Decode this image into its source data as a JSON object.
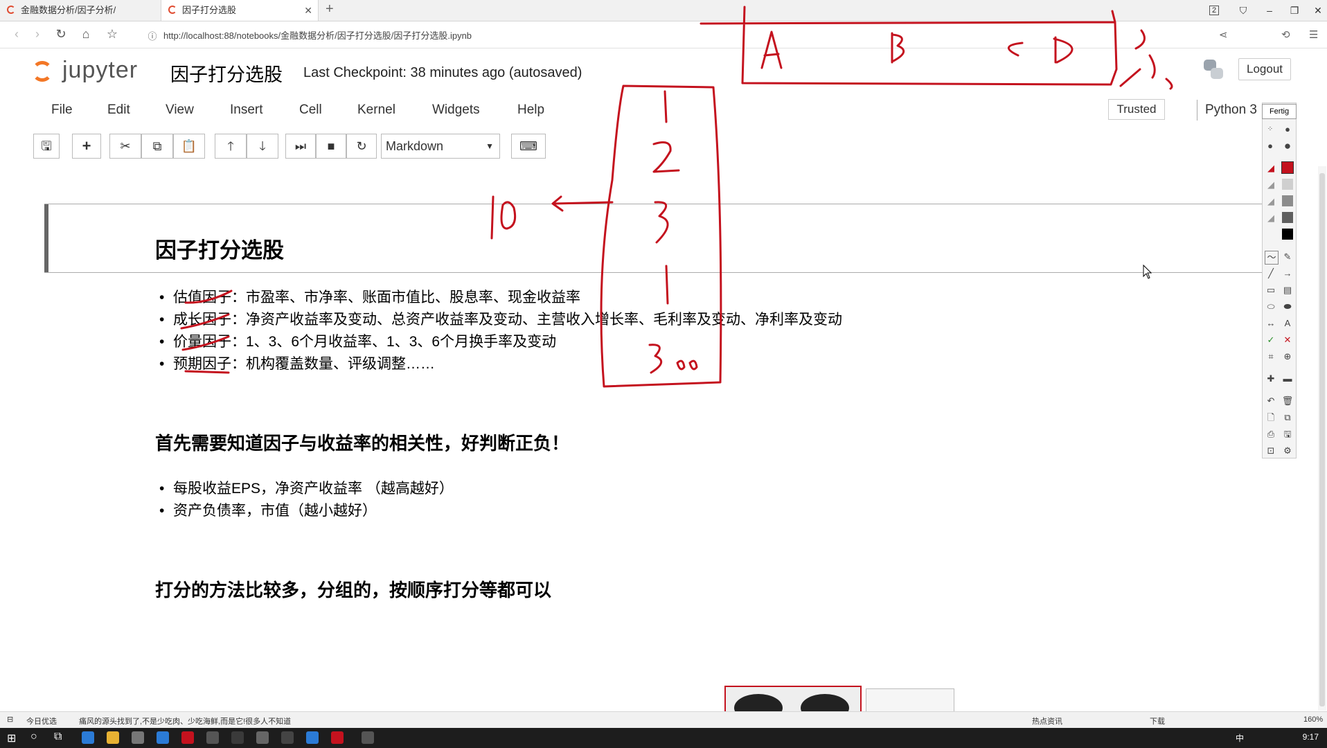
{
  "browser": {
    "tabs": [
      {
        "label": "金融数据分析/因子分析/"
      },
      {
        "label": "因子打分选股"
      }
    ],
    "url": "http://localhost:88/notebooks/金融数据分析/因子打分选股/因子打分选股.ipynb",
    "tab_counter": "2"
  },
  "jupyter": {
    "logo_text": "jupyter",
    "notebook_title": "因子打分选股",
    "checkpoint": "Last Checkpoint: 38 minutes ago (autosaved)",
    "logout": "Logout",
    "trusted": "Trusted",
    "kernel": "Python 3",
    "menu": [
      "File",
      "Edit",
      "View",
      "Insert",
      "Cell",
      "Kernel",
      "Widgets",
      "Help"
    ],
    "cell_type": "Markdown"
  },
  "notebook": {
    "heading": "因子打分选股",
    "factors": [
      "估值因子：市盈率、市净率、账面市值比、股息率、现金收益率",
      "成长因子：净资产收益率及变动、总资产收益率及变动、主营收入增长率、毛利率及变动、净利率及变动",
      "价量因子：1、3、6个月收益率、1、3、6个月换手率及变动",
      "预期因子：机构覆盖数量、评级调整……"
    ],
    "section2_title": "首先需要知道因子与收益率的相关性，好判断正负！",
    "section2_items": [
      "每股收益EPS，净资产收益率 （越高越好）",
      "资产负债率，市值（越小越好）"
    ],
    "section3_title": "打分的方法比较多，分组的，按顺序打分等都可以"
  },
  "annotation": {
    "panel_title": "Fertig",
    "ink_texts": [
      "A",
      "B",
      "C",
      "D",
      "1",
      "2",
      "3",
      "1",
      "300",
      "10"
    ],
    "ink_color": "#c4121e"
  },
  "statusbar": {
    "left": "今日优选",
    "news": "痛风的源头找到了,不是少吃肉、少吃海鲜,而是它!很多人不知道",
    "hot": "热点资讯",
    "download": "下载",
    "zoom": "160%"
  },
  "taskbar": {
    "time": "9:17",
    "ime": "中"
  }
}
